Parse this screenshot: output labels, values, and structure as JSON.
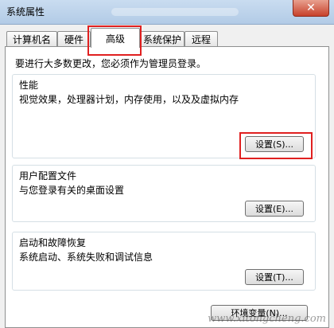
{
  "window": {
    "title": "系统属性",
    "close_glyph": "✕"
  },
  "tabs": [
    {
      "label": "计算机名"
    },
    {
      "label": "硬件"
    },
    {
      "label": "高级"
    },
    {
      "label": "系统保护"
    },
    {
      "label": "远程"
    }
  ],
  "panel": {
    "intro": "要进行大多数更改，您必须作为管理员登录。",
    "performance": {
      "title": "性能",
      "desc": "视觉效果，处理器计划，内存使用，以及及虚拟内存",
      "button": "设置(S)..."
    },
    "user_profile": {
      "title": "用户配置文件",
      "desc": "与您登录有关的桌面设置",
      "button": "设置(E)..."
    },
    "startup": {
      "title": "启动和故障恢复",
      "desc": "系统启动、系统失败和调试信息",
      "button": "设置(T)..."
    },
    "env_button": "环境变量(N)..."
  },
  "watermark": "www.xitongcheng.com",
  "colors": {
    "highlight": "#e02020",
    "close_button": "#c7412b"
  }
}
